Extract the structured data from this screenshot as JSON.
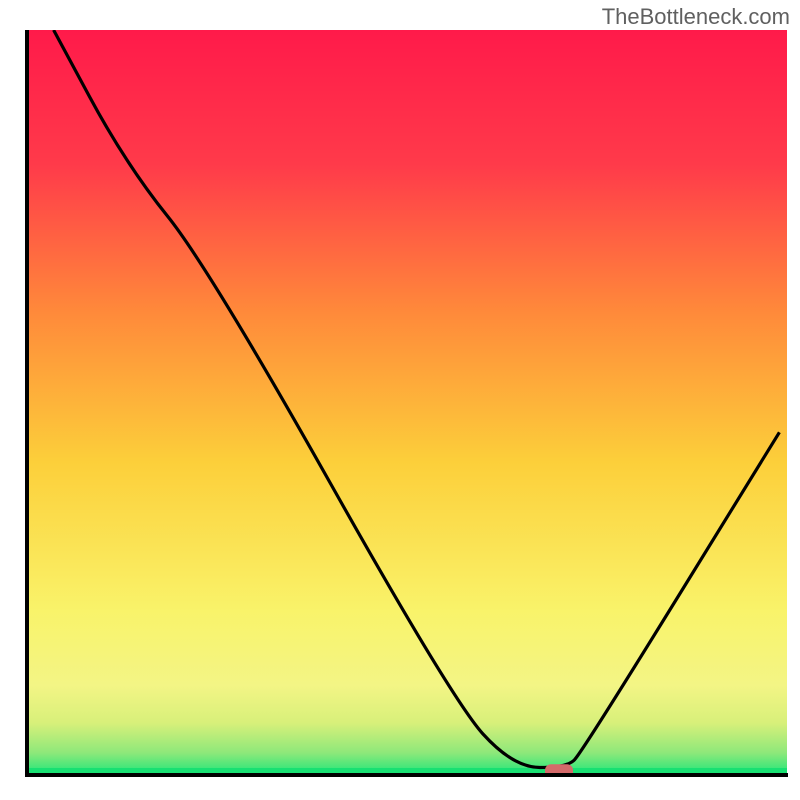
{
  "watermark": "TheBottleneck.com",
  "chart_data": {
    "type": "line",
    "title": "",
    "xlabel": "",
    "ylabel": "",
    "xlim": [
      0,
      100
    ],
    "ylim": [
      0,
      100
    ],
    "background_gradient": {
      "top": "#ff1a4a",
      "mid_upper": "#ff8a3a",
      "mid": "#fccf3a",
      "mid_lower": "#f9f36a",
      "bottom_band": "#d8f07a",
      "baseline": "#1ee67a"
    },
    "series": [
      {
        "name": "bottleneck-curve",
        "type": "line",
        "color": "#000000",
        "points": [
          {
            "x": 3.5,
            "y": 100
          },
          {
            "x": 13,
            "y": 82
          },
          {
            "x": 24,
            "y": 68
          },
          {
            "x": 56,
            "y": 10
          },
          {
            "x": 64,
            "y": 1
          },
          {
            "x": 71,
            "y": 1
          },
          {
            "x": 73,
            "y": 3
          },
          {
            "x": 99,
            "y": 46
          }
        ]
      }
    ],
    "marker": {
      "name": "optimal-point",
      "x": 70,
      "y": 0.5,
      "color": "#d46a6a",
      "shape": "rounded-rect"
    },
    "axes": {
      "left": {
        "x": 3,
        "y0": 0,
        "y1": 100
      },
      "bottom": {
        "y": 0,
        "x0": 3,
        "x1": 99
      }
    }
  }
}
